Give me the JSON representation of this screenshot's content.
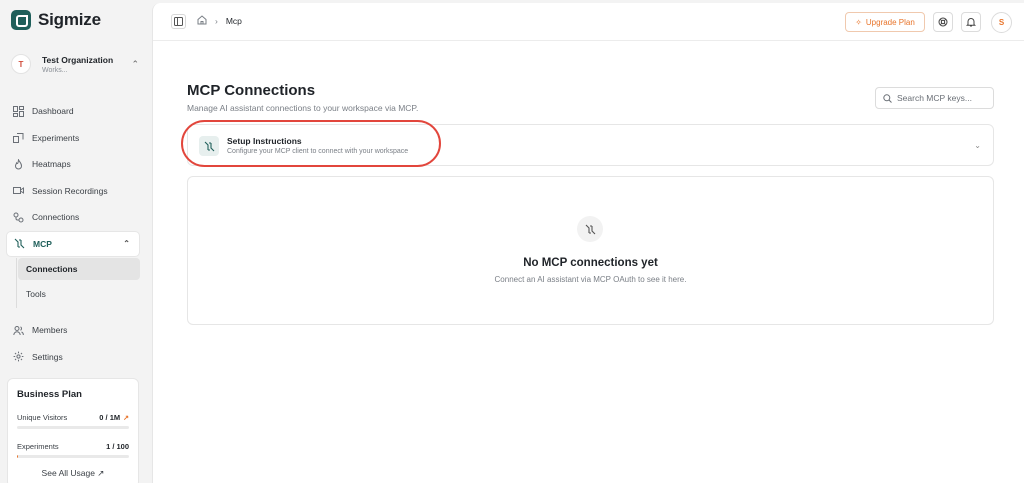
{
  "brand": {
    "name": "Sigmize",
    "accent": "#1f5f5a",
    "highlight": "#e8742a"
  },
  "org": {
    "avatar": "T",
    "name": "Test Organization",
    "workspace": "Works..."
  },
  "nav": {
    "items": [
      {
        "label": "Dashboard",
        "icon": "dashboard-icon"
      },
      {
        "label": "Experiments",
        "icon": "experiments-icon"
      },
      {
        "label": "Heatmaps",
        "icon": "flame-icon"
      },
      {
        "label": "Session Recordings",
        "icon": "video-icon"
      },
      {
        "label": "Connections",
        "icon": "connections-icon"
      },
      {
        "label": "MCP",
        "icon": "mcp-icon"
      }
    ],
    "sub": [
      {
        "label": "Connections"
      },
      {
        "label": "Tools"
      }
    ],
    "bottom": [
      {
        "label": "Members",
        "icon": "members-icon"
      },
      {
        "label": "Settings",
        "icon": "settings-icon"
      }
    ]
  },
  "plan": {
    "title": "Business Plan",
    "rows": [
      {
        "label": "Unique Visitors",
        "value": "0 / 1M",
        "progress": 0
      },
      {
        "label": "Experiments",
        "value": "1 / 100",
        "progress": 1
      }
    ],
    "link": "See All Usage ↗"
  },
  "topbar": {
    "breadcrumb": "Mcp",
    "upgrade_label": "Upgrade Plan",
    "user_initial": "S"
  },
  "page": {
    "title": "MCP Connections",
    "subtitle": "Manage AI assistant connections to your workspace via MCP.",
    "search_placeholder": "Search MCP keys..."
  },
  "setup": {
    "title": "Setup Instructions",
    "subtitle": "Configure your MCP client to connect with your workspace"
  },
  "empty": {
    "title": "No MCP connections yet",
    "subtitle": "Connect an AI assistant via MCP OAuth to see it here."
  }
}
